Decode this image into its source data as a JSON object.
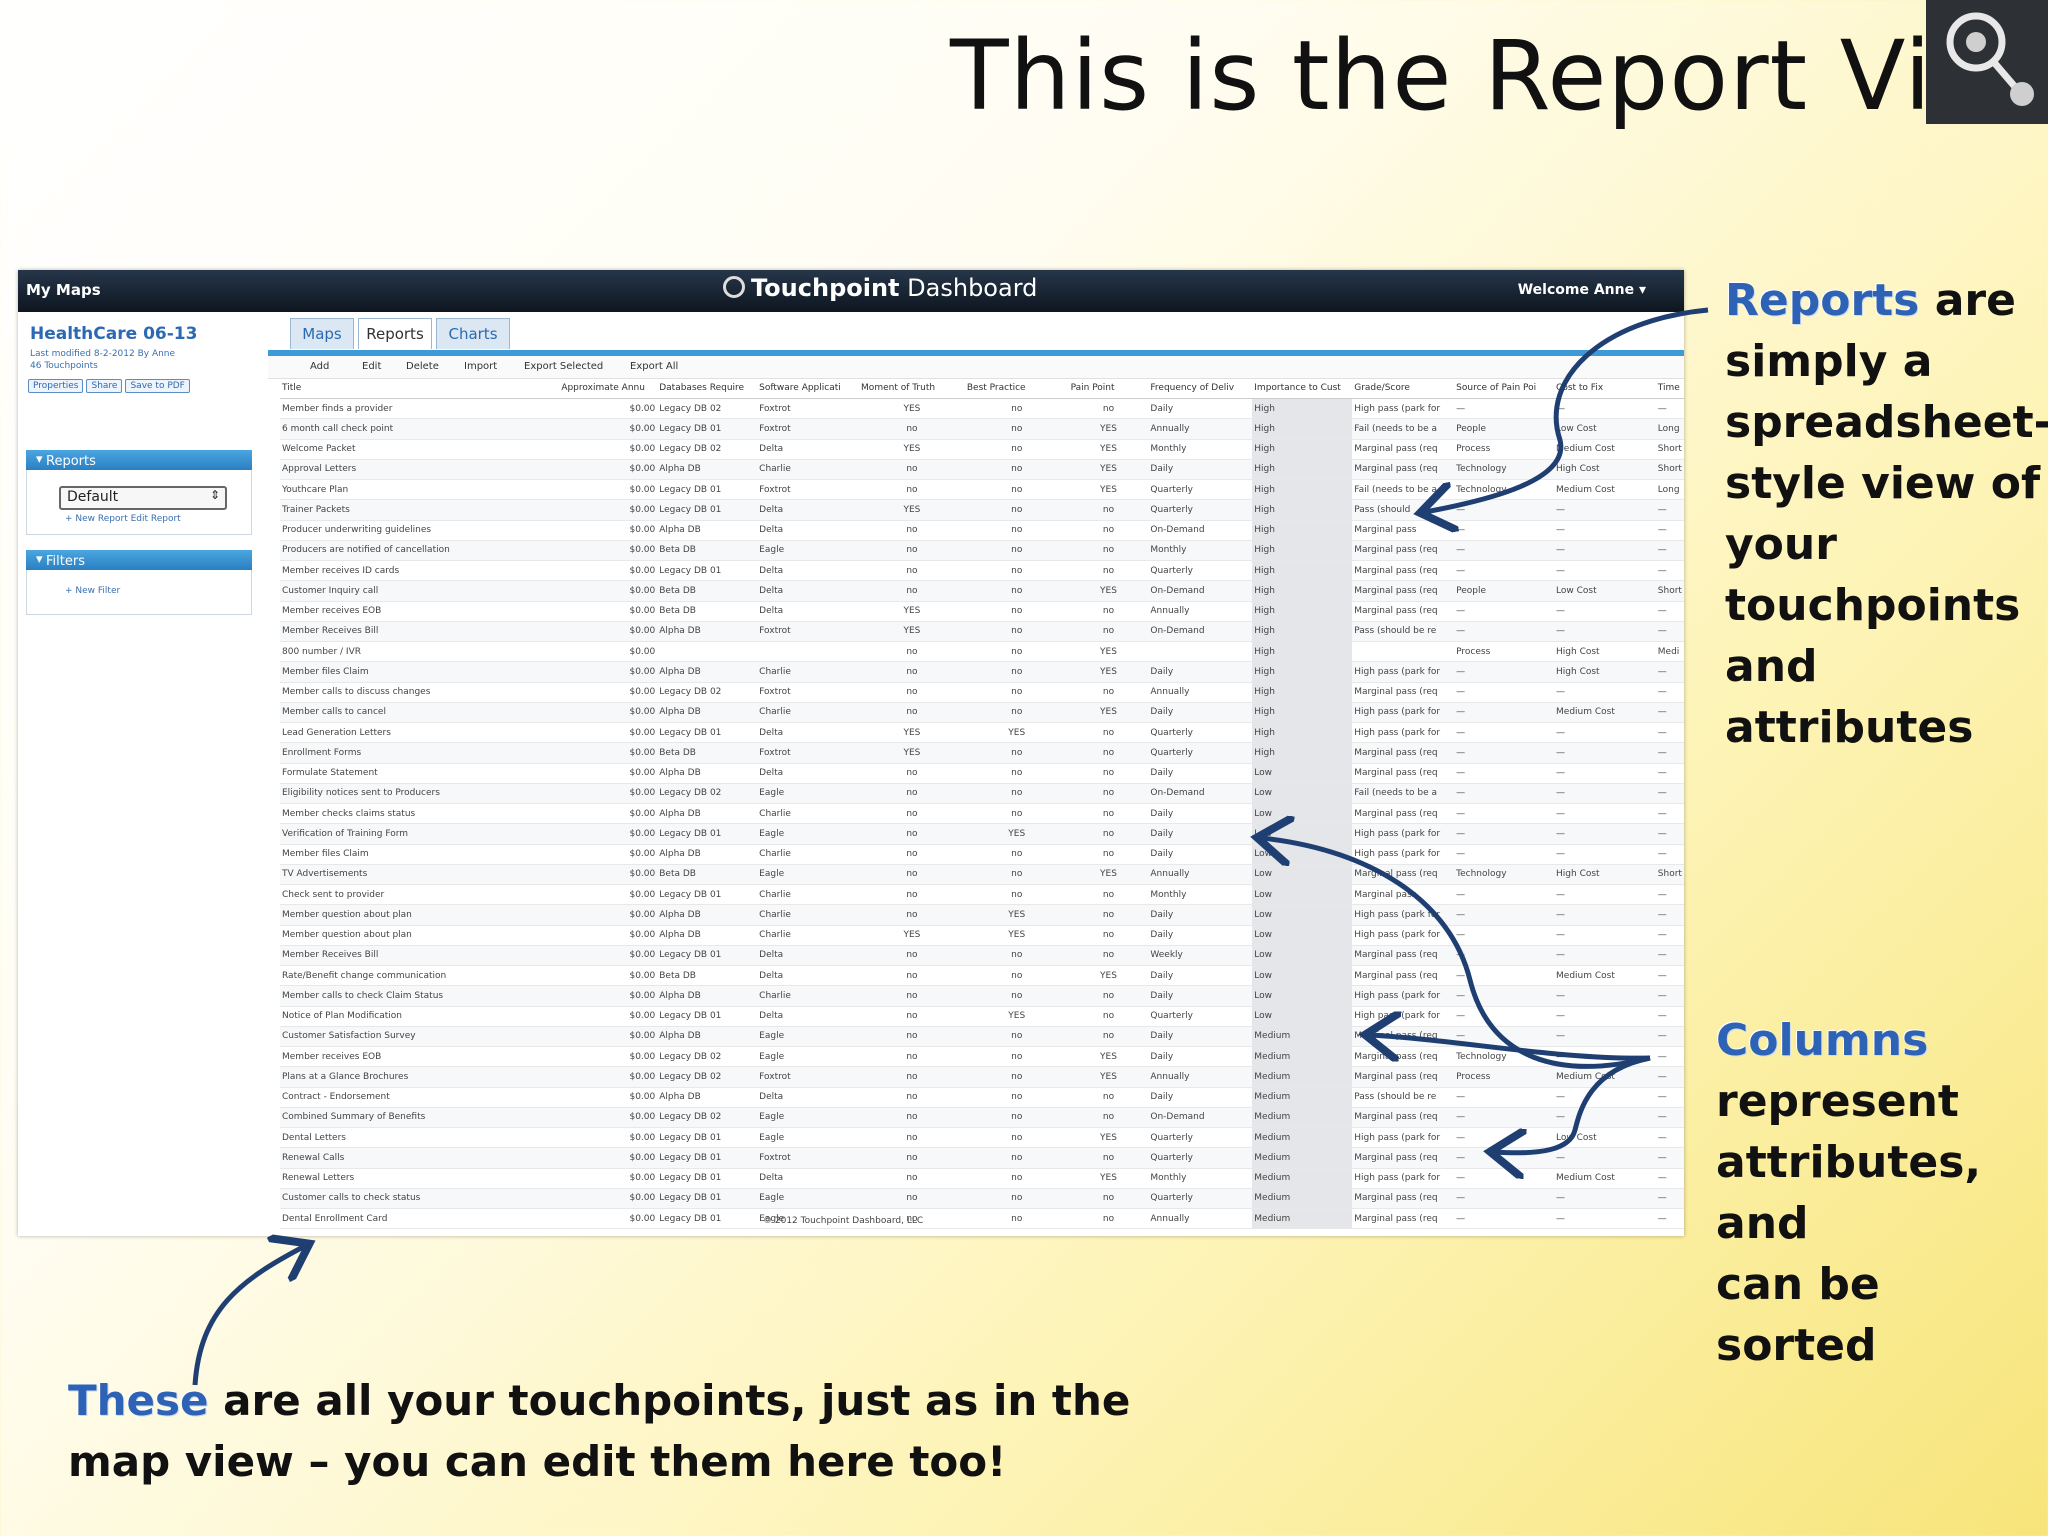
{
  "slide": {
    "title": "This is the Report View",
    "logo_icon": "touchpoint-logo-icon"
  },
  "app": {
    "top_left": "My Maps",
    "brand_bold": "Touchpoint",
    "brand_rest": " Dashboard",
    "welcome": "Welcome Anne ▾",
    "copyright": "© 2012 Touchpoint Dashboard, LLC"
  },
  "sidebar": {
    "map_name": "HealthCare 06-13",
    "meta_line1": "Last modified 8-2-2012 By Anne",
    "meta_line2": "46 Touchpoints",
    "buttons": [
      "Properties",
      "Share",
      "Save to PDF"
    ],
    "reports_header": "Reports",
    "report_select": "Default",
    "report_links": "+ New Report   Edit Report",
    "filters_header": "Filters",
    "filter_links": "+ New Filter"
  },
  "tabs": [
    "Maps",
    "Reports",
    "Charts"
  ],
  "toolbar": [
    "Add",
    "Edit",
    "Delete",
    "Import",
    "Export Selected",
    "Export All"
  ],
  "table": {
    "columns": [
      "Title",
      "Approximate Annu",
      "Databases Require",
      "Software Applicati",
      "Moment of Truth",
      "Best Practice",
      "Pain Point",
      "Frequency of Deliv",
      "Importance to Cust",
      "Grade/Score",
      "Source of Pain Poi",
      "Cost to Fix",
      "Time"
    ],
    "rows": [
      [
        "Member finds a provider",
        "$0.00",
        "Legacy DB 02",
        "Foxtrot",
        "YES",
        "no",
        "no",
        "Daily",
        "High",
        "High pass (park for",
        "—",
        "—",
        "—"
      ],
      [
        "6 month call check point",
        "$0.00",
        "Legacy DB 01",
        "Foxtrot",
        "no",
        "no",
        "YES",
        "Annually",
        "High",
        "Fail (needs to be a",
        "People",
        "Low Cost",
        "Long"
      ],
      [
        "Welcome Packet",
        "$0.00",
        "Legacy DB 02",
        "Delta",
        "YES",
        "no",
        "YES",
        "Monthly",
        "High",
        "Marginal pass (req",
        "Process",
        "Medium Cost",
        "Short"
      ],
      [
        "Approval Letters",
        "$0.00",
        "Alpha DB",
        "Charlie",
        "no",
        "no",
        "YES",
        "Daily",
        "High",
        "Marginal pass (req",
        "Technology",
        "High Cost",
        "Short"
      ],
      [
        "Youthcare Plan",
        "$0.00",
        "Legacy DB 01",
        "Foxtrot",
        "no",
        "no",
        "YES",
        "Quarterly",
        "High",
        "Fail (needs to be a",
        "Technology",
        "Medium Cost",
        "Long"
      ],
      [
        "Trainer Packets",
        "$0.00",
        "Legacy DB 01",
        "Delta",
        "YES",
        "no",
        "no",
        "Quarterly",
        "High",
        "Pass (should",
        "—",
        "—",
        "—"
      ],
      [
        "Producer underwriting guidelines",
        "$0.00",
        "Alpha DB",
        "Delta",
        "no",
        "no",
        "no",
        "On-Demand",
        "High",
        "Marginal pass",
        "—",
        "—",
        "—"
      ],
      [
        "Producers are notified of cancellation",
        "$0.00",
        "Beta DB",
        "Eagle",
        "no",
        "no",
        "no",
        "Monthly",
        "High",
        "Marginal pass (req",
        "—",
        "—",
        "—"
      ],
      [
        "Member receives ID cards",
        "$0.00",
        "Legacy DB 01",
        "Delta",
        "no",
        "no",
        "no",
        "Quarterly",
        "High",
        "Marginal pass (req",
        "—",
        "—",
        "—"
      ],
      [
        "Customer Inquiry call",
        "$0.00",
        "Beta DB",
        "Delta",
        "no",
        "no",
        "YES",
        "On-Demand",
        "High",
        "Marginal pass (req",
        "People",
        "Low Cost",
        "Short"
      ],
      [
        "Member receives EOB",
        "$0.00",
        "Beta DB",
        "Delta",
        "YES",
        "no",
        "no",
        "Annually",
        "High",
        "Marginal pass (req",
        "—",
        "—",
        "—"
      ],
      [
        "Member Receives Bill",
        "$0.00",
        "Alpha DB",
        "Foxtrot",
        "YES",
        "no",
        "no",
        "On-Demand",
        "High",
        "Pass (should be re",
        "—",
        "—",
        "—"
      ],
      [
        "800 number / IVR",
        "$0.00",
        "",
        "",
        "no",
        "no",
        "YES",
        "",
        "High",
        "",
        "Process",
        "High Cost",
        "Medi"
      ],
      [
        "Member files Claim",
        "$0.00",
        "Alpha DB",
        "Charlie",
        "no",
        "no",
        "YES",
        "Daily",
        "High",
        "High pass (park for",
        "—",
        "High Cost",
        "—"
      ],
      [
        "Member calls to discuss changes",
        "$0.00",
        "Legacy DB 02",
        "Foxtrot",
        "no",
        "no",
        "no",
        "Annually",
        "High",
        "Marginal pass (req",
        "—",
        "—",
        "—"
      ],
      [
        "Member calls to cancel",
        "$0.00",
        "Alpha DB",
        "Charlie",
        "no",
        "no",
        "YES",
        "Daily",
        "High",
        "High pass (park for",
        "—",
        "Medium Cost",
        "—"
      ],
      [
        "Lead Generation Letters",
        "$0.00",
        "Legacy DB 01",
        "Delta",
        "YES",
        "YES",
        "no",
        "Quarterly",
        "High",
        "High pass (park for",
        "—",
        "—",
        "—"
      ],
      [
        "Enrollment Forms",
        "$0.00",
        "Beta DB",
        "Foxtrot",
        "YES",
        "no",
        "no",
        "Quarterly",
        "High",
        "Marginal pass (req",
        "—",
        "—",
        "—"
      ],
      [
        "Formulate Statement",
        "$0.00",
        "Alpha DB",
        "Delta",
        "no",
        "no",
        "no",
        "Daily",
        "Low",
        "Marginal pass (req",
        "—",
        "—",
        "—"
      ],
      [
        "Eligibility notices sent to Producers",
        "$0.00",
        "Legacy DB 02",
        "Eagle",
        "no",
        "no",
        "no",
        "On-Demand",
        "Low",
        "Fail (needs to be a",
        "—",
        "—",
        "—"
      ],
      [
        "Member checks claims status",
        "$0.00",
        "Alpha DB",
        "Charlie",
        "no",
        "no",
        "no",
        "Daily",
        "Low",
        "Marginal pass (req",
        "—",
        "—",
        "—"
      ],
      [
        "Verification of Training Form",
        "$0.00",
        "Legacy DB 01",
        "Eagle",
        "no",
        "YES",
        "no",
        "Daily",
        "Low",
        "High pass (park for",
        "—",
        "—",
        "—"
      ],
      [
        "Member files Claim",
        "$0.00",
        "Alpha DB",
        "Charlie",
        "no",
        "no",
        "no",
        "Daily",
        "Low",
        "High pass (park for",
        "—",
        "—",
        "—"
      ],
      [
        "TV Advertisements",
        "$0.00",
        "Beta DB",
        "Eagle",
        "no",
        "no",
        "YES",
        "Annually",
        "Low",
        "Marginal pass (req",
        "Technology",
        "High Cost",
        "Short"
      ],
      [
        "Check sent to provider",
        "$0.00",
        "Legacy DB 01",
        "Charlie",
        "no",
        "no",
        "no",
        "Monthly",
        "Low",
        "Marginal pass",
        "—",
        "—",
        "—"
      ],
      [
        "Member question about plan",
        "$0.00",
        "Alpha DB",
        "Charlie",
        "no",
        "YES",
        "no",
        "Daily",
        "Low",
        "High pass (park for",
        "—",
        "—",
        "—"
      ],
      [
        "Member question about plan",
        "$0.00",
        "Alpha DB",
        "Charlie",
        "YES",
        "YES",
        "no",
        "Daily",
        "Low",
        "High pass (park for",
        "—",
        "—",
        "—"
      ],
      [
        "Member Receives Bill",
        "$0.00",
        "Legacy DB 01",
        "Delta",
        "no",
        "no",
        "no",
        "Weekly",
        "Low",
        "Marginal pass (req",
        "—",
        "—",
        "—"
      ],
      [
        "Rate/Benefit change communication",
        "$0.00",
        "Beta DB",
        "Delta",
        "no",
        "no",
        "YES",
        "Daily",
        "Low",
        "Marginal pass (req",
        "—",
        "Medium Cost",
        "—"
      ],
      [
        "Member calls to check Claim Status",
        "$0.00",
        "Alpha DB",
        "Charlie",
        "no",
        "no",
        "no",
        "Daily",
        "Low",
        "High pass (park for",
        "—",
        "—",
        "—"
      ],
      [
        "Notice of Plan Modification",
        "$0.00",
        "Legacy DB 01",
        "Delta",
        "no",
        "YES",
        "no",
        "Quarterly",
        "Low",
        "High pass (park for",
        "—",
        "—",
        "—"
      ],
      [
        "Customer Satisfaction Survey",
        "$0.00",
        "Alpha DB",
        "Eagle",
        "no",
        "no",
        "no",
        "Daily",
        "Medium",
        "Marginal pass (req",
        "—",
        "—",
        "—"
      ],
      [
        "Member receives EOB",
        "$0.00",
        "Legacy DB 02",
        "Eagle",
        "no",
        "no",
        "YES",
        "Daily",
        "Medium",
        "Marginal pass (req",
        "Technology",
        "—",
        "—"
      ],
      [
        "Plans at a Glance Brochures",
        "$0.00",
        "Legacy DB 02",
        "Foxtrot",
        "no",
        "no",
        "YES",
        "Annually",
        "Medium",
        "Marginal pass (req",
        "Process",
        "Medium Cost",
        "—"
      ],
      [
        "Contract - Endorsement",
        "$0.00",
        "Alpha DB",
        "Delta",
        "no",
        "no",
        "no",
        "Daily",
        "Medium",
        "Pass (should be re",
        "—",
        "—",
        "—"
      ],
      [
        "Combined Summary of Benefits",
        "$0.00",
        "Legacy DB 02",
        "Eagle",
        "no",
        "no",
        "no",
        "On-Demand",
        "Medium",
        "Marginal pass (req",
        "—",
        "—",
        "—"
      ],
      [
        "Dental Letters",
        "$0.00",
        "Legacy DB 01",
        "Eagle",
        "no",
        "no",
        "YES",
        "Quarterly",
        "Medium",
        "High pass (park for",
        "—",
        "Low Cost",
        "—"
      ],
      [
        "Renewal Calls",
        "$0.00",
        "Legacy DB 01",
        "Foxtrot",
        "no",
        "no",
        "no",
        "Quarterly",
        "Medium",
        "Marginal pass (req",
        "—",
        "—",
        "—"
      ],
      [
        "Renewal Letters",
        "$0.00",
        "Legacy DB 01",
        "Delta",
        "no",
        "no",
        "YES",
        "Monthly",
        "Medium",
        "High pass (park for",
        "—",
        "Medium Cost",
        "—"
      ],
      [
        "Customer calls to check status",
        "$0.00",
        "Legacy DB 01",
        "Eagle",
        "no",
        "no",
        "no",
        "Quarterly",
        "Medium",
        "Marginal pass (req",
        "—",
        "—",
        "—"
      ],
      [
        "Dental Enrollment Card",
        "$0.00",
        "Legacy DB 01",
        "Eagle",
        "no",
        "no",
        "no",
        "Annually",
        "Medium",
        "Marginal pass (req",
        "—",
        "—",
        "—"
      ]
    ]
  },
  "notes": {
    "reports_kw": "Reports",
    "reports_rest1": " are",
    "reports_lines": [
      "simply a",
      "spreadsheet-",
      "style view of",
      "your",
      "touchpoints",
      "and",
      "attributes"
    ],
    "columns_kw": "Columns",
    "columns_lines": [
      "represent",
      "attributes, and",
      "can be sorted"
    ],
    "these_kw": "These",
    "these_rest": " are all your touchpoints, just as in the",
    "these_line2": "map view – you can edit them here too!"
  },
  "colors": {
    "accent": "#2d62b5",
    "arrow": "#1f3f73"
  }
}
